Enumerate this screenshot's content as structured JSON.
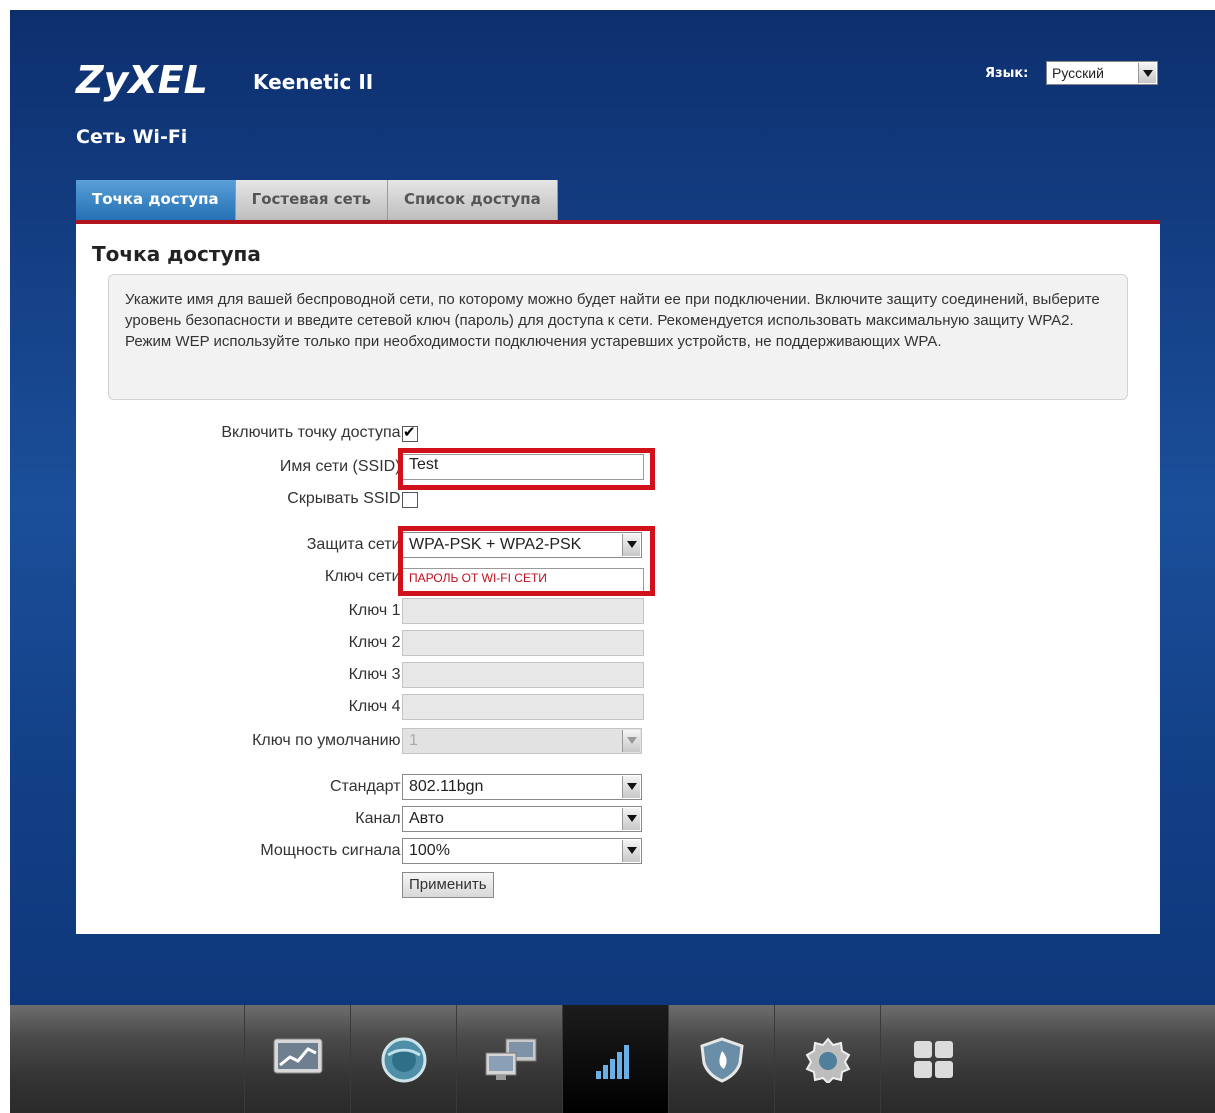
{
  "header": {
    "brand": "ZyXEL",
    "model": "Keenetic II",
    "language_label": "Язык:",
    "language_value": "Русский",
    "section_title": "Сеть Wi-Fi"
  },
  "tabs": [
    {
      "label": "Точка доступа",
      "active": true
    },
    {
      "label": "Гостевая сеть",
      "active": false
    },
    {
      "label": "Список доступа",
      "active": false
    }
  ],
  "panel": {
    "title": "Точка доступа",
    "info_text": "Укажите имя для вашей беспроводной сети, по которому можно будет найти ее при подключении. Включите защиту соединений, выберите уровень безопасности и введите сетевой ключ (пароль) для доступа к сети. Рекомендуется использовать максимальную защиту WPA2. Режим WEP используйте только при необходимости подключения устаревших устройств, не поддерживающих WPA."
  },
  "form": {
    "enable_ap": {
      "label": "Включить точку доступа:",
      "checked": true
    },
    "ssid": {
      "label": "Имя сети (SSID):",
      "value": "Test"
    },
    "hide_ssid": {
      "label": "Скрывать SSID:",
      "checked": false
    },
    "security": {
      "label": "Защита сети:",
      "value": "WPA-PSK + WPA2-PSK"
    },
    "network_key": {
      "label": "Ключ сети:",
      "value": "ПАРОЛЬ ОТ WI-FI СЕТИ"
    },
    "key1": {
      "label": "Ключ 1:",
      "value": ""
    },
    "key2": {
      "label": "Ключ 2:",
      "value": ""
    },
    "key3": {
      "label": "Ключ 3:",
      "value": ""
    },
    "key4": {
      "label": "Ключ 4:",
      "value": ""
    },
    "default_key": {
      "label": "Ключ по умолчанию:",
      "value": "1"
    },
    "standard": {
      "label": "Стандарт:",
      "value": "802.11bgn"
    },
    "channel": {
      "label": "Канал:",
      "value": "Авто"
    },
    "power": {
      "label": "Мощность сигнала:",
      "value": "100%"
    },
    "apply_label": "Применить"
  },
  "dock": [
    {
      "icon": "monitor-chart-icon",
      "active": false
    },
    {
      "icon": "globe-icon",
      "active": false
    },
    {
      "icon": "computers-icon",
      "active": false
    },
    {
      "icon": "wifi-signal-icon",
      "active": true
    },
    {
      "icon": "shield-icon",
      "active": false
    },
    {
      "icon": "gear-icon",
      "active": false
    },
    {
      "icon": "apps-grid-icon",
      "active": false
    }
  ],
  "colors": {
    "accent": "#b3131c",
    "highlight": "#d0111c",
    "tab_active": "#2470b4"
  }
}
